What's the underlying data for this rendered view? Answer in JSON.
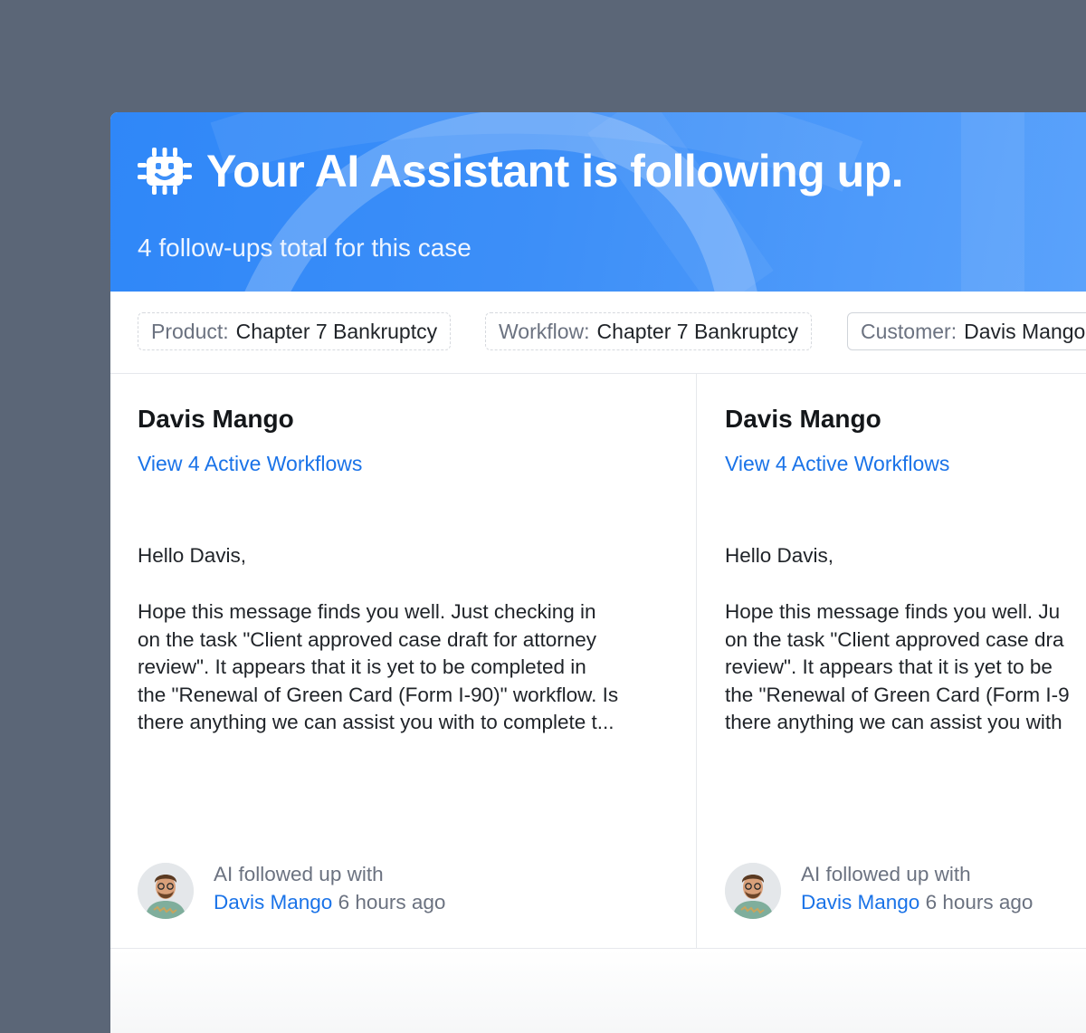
{
  "hero": {
    "title": "Your AI Assistant is following up.",
    "subtitle": "4 follow-ups total for this case",
    "icon": "robot-chip-icon",
    "accent_color": "#2f87f8"
  },
  "tags": [
    {
      "key": "Product:",
      "value": "Chapter 7 Bankruptcy"
    },
    {
      "key": "Workflow:",
      "value": "Chapter 7 Bankruptcy"
    },
    {
      "key": "Customer:",
      "value": "Davis Mango"
    }
  ],
  "cards": [
    {
      "name": "Davis Mango",
      "link": "View 4 Active Workflows",
      "greeting": "Hello Davis,",
      "body_lines": [
        "Hope this message finds you well. Just checking in",
        "on the task \"Client approved case draft for attorney",
        "review\". It appears that it is yet to be completed in",
        "the \"Renewal of Green Card (Form I-90)\" workflow. Is",
        "there anything we can assist you with to complete t..."
      ],
      "footer_line1": "AI followed up with",
      "footer_person": "Davis Mango",
      "footer_time": "6 hours ago"
    },
    {
      "name": "Davis Mango",
      "link": "View 4 Active Workflows",
      "greeting": "Hello Davis,",
      "body_lines": [
        "Hope this message finds you well. Ju",
        "on the task \"Client approved case dra",
        "review\". It appears that it is yet to be",
        "the \"Renewal of Green Card (Form I-9",
        "there anything we can assist you with"
      ],
      "footer_line1": "AI followed up with",
      "footer_person": "Davis Mango",
      "footer_time": "6 hours ago"
    }
  ]
}
